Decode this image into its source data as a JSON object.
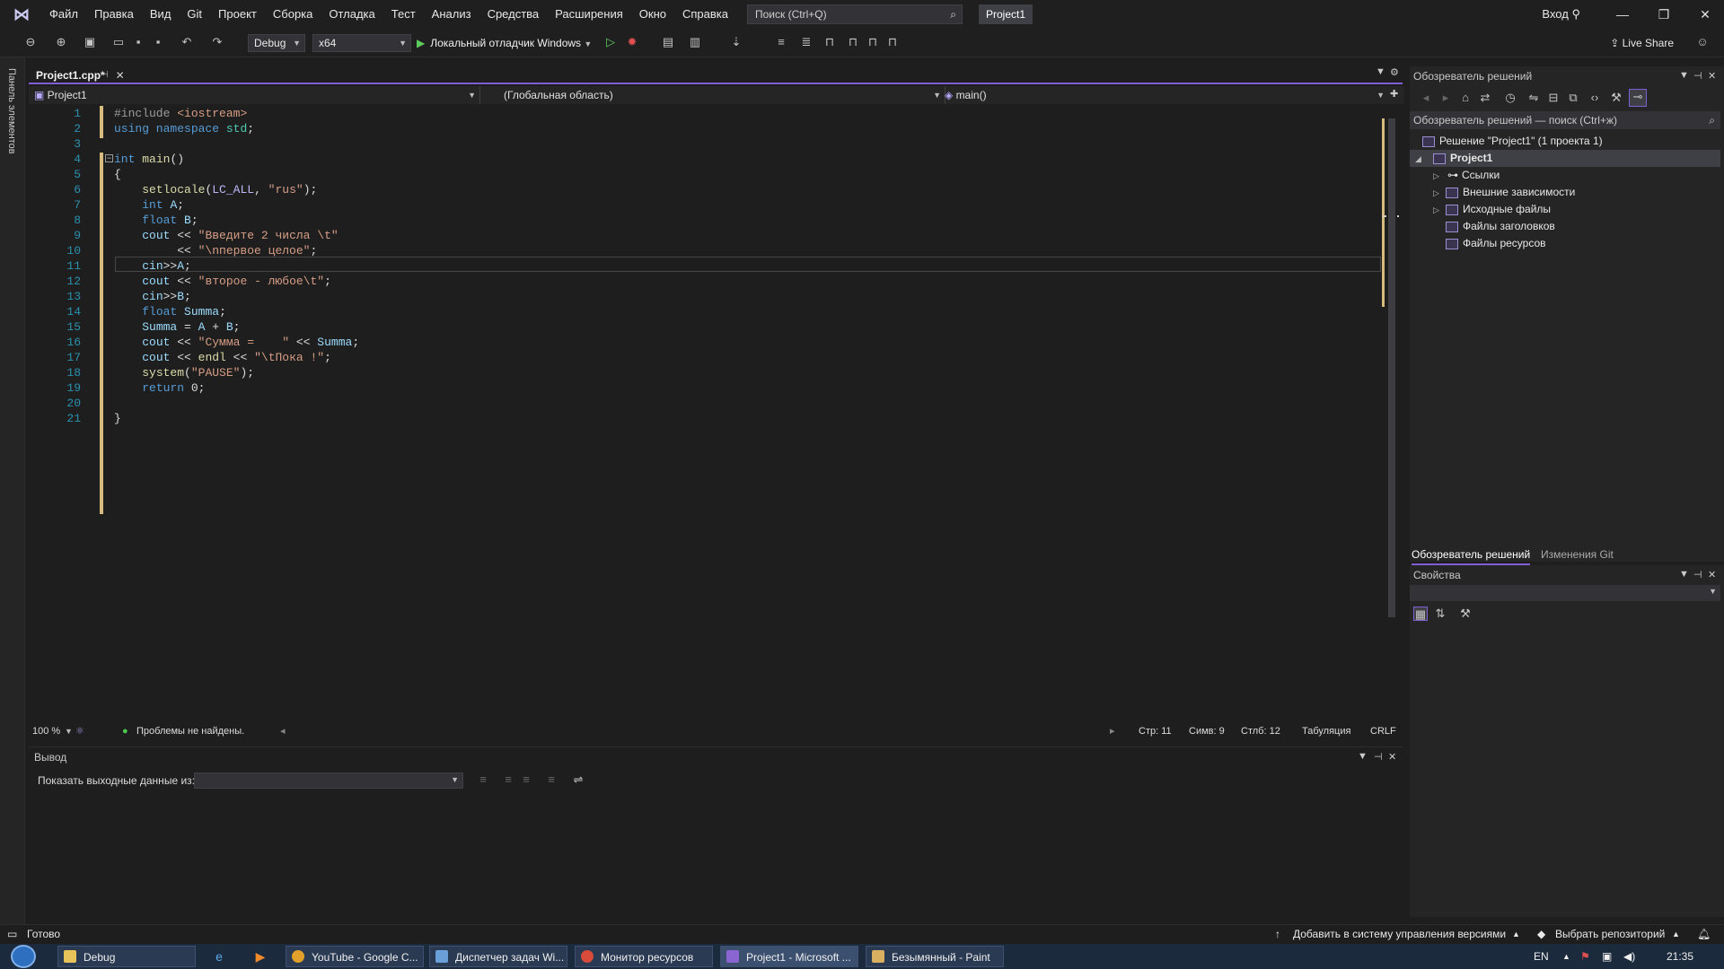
{
  "menubar": {
    "items": [
      "Файл",
      "Правка",
      "Вид",
      "Git",
      "Проект",
      "Сборка",
      "Отладка",
      "Тест",
      "Анализ",
      "Средства",
      "Расширения",
      "Окно",
      "Справка"
    ],
    "search_placeholder": "Поиск (Ctrl+Q)",
    "project_badge": "Project1",
    "signin": "Вход"
  },
  "toolbar": {
    "config": "Debug",
    "platform": "x64",
    "run_label": "Локальный отладчик Windows",
    "live_share": "Live Share"
  },
  "leftstrip": {
    "label": "Панель элементов"
  },
  "editor": {
    "tab_label": "Project1.cpp*",
    "nav_project": "Project1",
    "nav_scope": "(Глобальная область)",
    "nav_member": "main()",
    "line_numbers": [
      "1",
      "2",
      "3",
      "4",
      "5",
      "6",
      "7",
      "8",
      "9",
      "10",
      "11",
      "12",
      "13",
      "14",
      "15",
      "16",
      "17",
      "18",
      "19",
      "20",
      "21"
    ],
    "lines": [
      "#include <iostream>",
      "using namespace std;",
      "",
      "int main()",
      "{",
      "    setlocale(LC_ALL, \"rus\");",
      "    int A;",
      "    float B;",
      "    cout << \"Введите 2 числа \\t\"",
      "         << \"\\nпервое целое\";",
      "    cin>>A;",
      "    cout << \"второе - любое\\t\";",
      "    cin>>B;",
      "    float Summa;",
      "    Summa = A + B;",
      "    cout << \"Сумма =    \" << Summa;",
      "    cout << endl << \"\\tПока !\";",
      "    system(\"PAUSE\");",
      "    return 0;",
      "",
      "}"
    ],
    "current_line": 11
  },
  "editor_status": {
    "zoom": "100 %",
    "issues": "Проблемы не найдены.",
    "line": "Стр: 11",
    "char": "Симв: 9",
    "col": "Стлб: 12",
    "indent": "Табуляция",
    "eol": "CRLF"
  },
  "output": {
    "title": "Вывод",
    "show_from_label": "Показать выходные данные из:"
  },
  "solution_explorer": {
    "title": "Обозреватель решений",
    "search_placeholder": "Обозреватель решений — поиск (Ctrl+ж)",
    "tree": [
      {
        "label": "Решение \"Project1\"  (1 проекта 1)",
        "depth": 0,
        "expander": ""
      },
      {
        "label": "Project1",
        "depth": 1,
        "expander": "◢"
      },
      {
        "label": "Ссылки",
        "depth": 2,
        "expander": "▷"
      },
      {
        "label": "Внешние зависимости",
        "depth": 2,
        "expander": "▷"
      },
      {
        "label": "Исходные файлы",
        "depth": 2,
        "expander": "▷"
      },
      {
        "label": "Файлы заголовков",
        "depth": 2,
        "expander": ""
      },
      {
        "label": "Файлы ресурсов",
        "depth": 2,
        "expander": ""
      }
    ],
    "tab_active": "Обозреватель решений",
    "tab_git": "Изменения Git"
  },
  "properties": {
    "title": "Свойства"
  },
  "statusbar": {
    "ready": "Готово",
    "add_to_vcs": "Добавить в систему управления версиями",
    "select_repo": "Выбрать репозиторий"
  },
  "taskbar": {
    "buttons": [
      {
        "label": "Debug",
        "icon_color": "#e8c35a"
      },
      {
        "label": "YouTube - Google C...",
        "icon_color": "#e0a02a"
      },
      {
        "label": "Диспетчер задач Wi...",
        "icon_color": "#6aa0d8"
      },
      {
        "label": "Монитор ресурсов",
        "icon_color": "#d84a3a"
      },
      {
        "label": "Project1 - Microsoft ...",
        "icon_color": "#8a64d0"
      },
      {
        "label": "Безымянный - Paint",
        "icon_color": "#d8b060"
      }
    ],
    "lang": "EN",
    "time": "21:35"
  },
  "colors": {
    "accent": "#7f5fd1",
    "change_marker": "#d7ba7d",
    "ok": "#4ec94e"
  }
}
